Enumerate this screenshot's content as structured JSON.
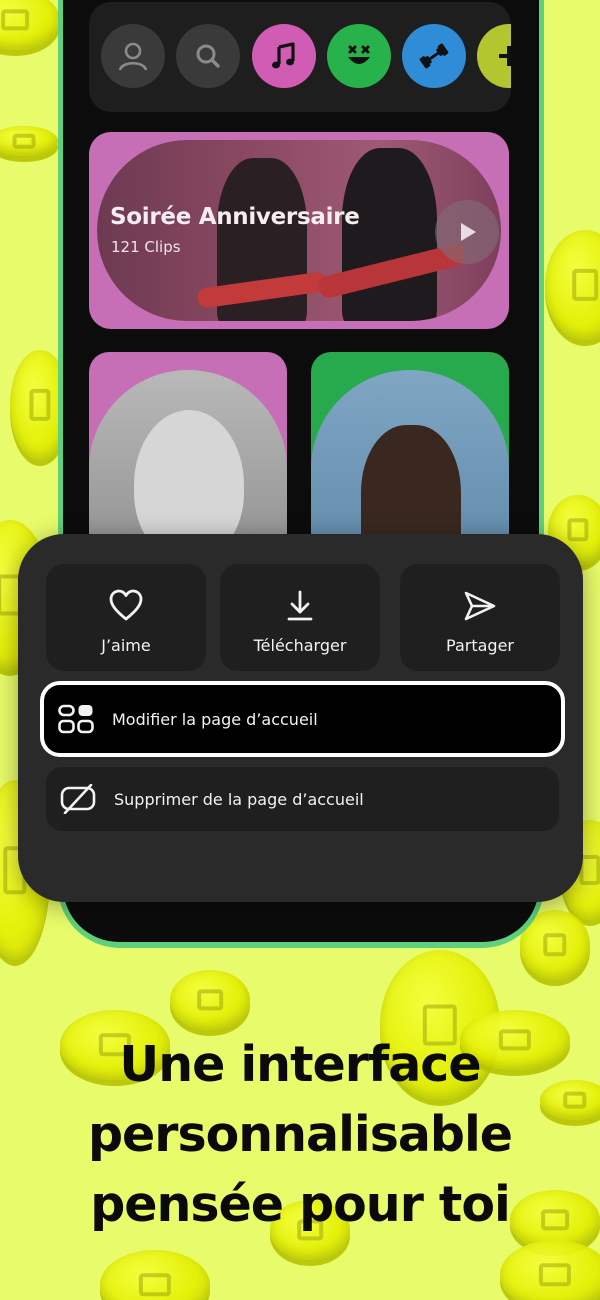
{
  "topbar": {
    "icons": [
      {
        "name": "profile-icon",
        "bg": "#3a3a3a"
      },
      {
        "name": "search-icon",
        "bg": "#3a3a3a"
      },
      {
        "name": "music-note-icon",
        "bg": "#d15cb3"
      },
      {
        "name": "smiley-icon",
        "bg": "#27b24b"
      },
      {
        "name": "dumbbell-icon",
        "bg": "#2f8cd6"
      },
      {
        "name": "plus-icon",
        "bg": "#b3c52f"
      }
    ]
  },
  "featured": {
    "title": "Soirée Anniversaire",
    "subtitle": "121 Clips",
    "color": "#c66fb7"
  },
  "cards": [
    {
      "color": "#c66fb7"
    },
    {
      "color": "#27a94e"
    }
  ],
  "sheet": {
    "actions": [
      {
        "label": "J’aime",
        "icon": "heart-icon"
      },
      {
        "label": "Télécharger",
        "icon": "download-icon"
      },
      {
        "label": "Partager",
        "icon": "send-icon"
      }
    ],
    "options": [
      {
        "label": "Modifier la page d’accueil",
        "icon": "layout-grid-icon",
        "selected": true
      },
      {
        "label": "Supprimer de la page d’accueil",
        "icon": "hide-icon",
        "selected": false
      }
    ]
  },
  "headline": {
    "line1": "Une interface",
    "line2": "personnalisable",
    "line3": "pensée pour toi"
  },
  "colors": {
    "background": "#e8fb6a",
    "phone_frame": "#5fd07c",
    "sheet": "#2a2a2a",
    "tile": "#1f1f1f"
  }
}
